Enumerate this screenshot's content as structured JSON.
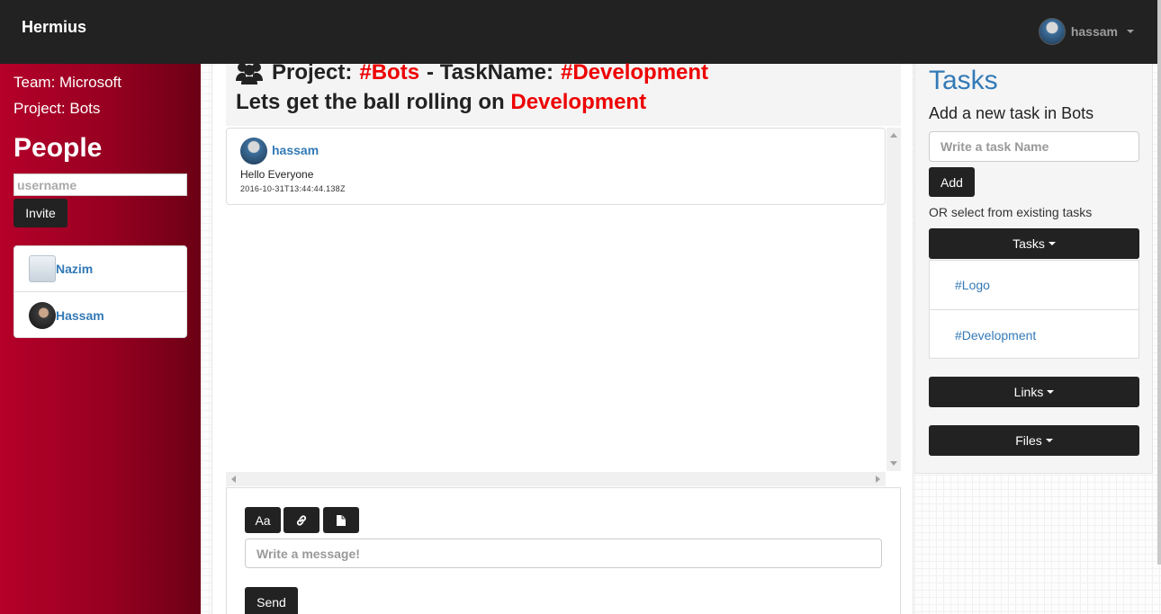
{
  "navbar": {
    "brand": "Hermius",
    "user_name": "hassam"
  },
  "sidebar": {
    "team_label": "Team: Microsoft",
    "project_label": "Project: Bots",
    "people_title": "People",
    "invite_placeholder": "username",
    "invite_button": "Invite",
    "people": [
      {
        "name": "Nazim"
      },
      {
        "name": "Hassam"
      }
    ]
  },
  "header": {
    "project_prefix": "Project:",
    "project_tag": "#Bots",
    "task_prefix": "- TaskName:",
    "task_tag": "#Development",
    "subtitle_prefix": "Lets get the ball rolling on",
    "subtitle_task": "Development"
  },
  "messages": [
    {
      "author": "hassam",
      "text": "Hello Everyone",
      "timestamp": "2016-10-31T13:44:44.138Z"
    }
  ],
  "composer": {
    "format_button": "Aa",
    "link_icon": "link-icon",
    "file_icon": "file-icon",
    "placeholder": "Write a message!",
    "send_button": "Send"
  },
  "tasks_panel": {
    "title": "Tasks",
    "subtitle": "Add a new task in Bots",
    "task_placeholder": "Write a task Name",
    "add_button": "Add",
    "or_text": "OR select from existing tasks",
    "tasks_dropdown": "Tasks",
    "task_items": [
      "#Logo",
      "#Development"
    ],
    "links_dropdown": "Links",
    "files_dropdown": "Files"
  },
  "colors": {
    "navbar": "#222222",
    "sidebar": "#a0001f",
    "accent_red": "#ee0000",
    "link_blue": "#337ab7"
  }
}
